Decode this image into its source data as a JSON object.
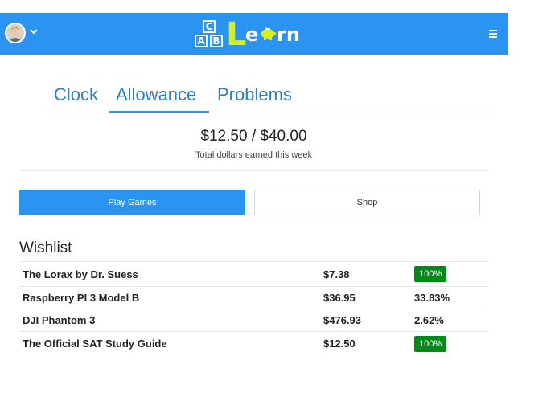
{
  "header": {
    "logo": {
      "blocks": [
        "C",
        "A",
        "B"
      ],
      "word_letters": [
        "L",
        "e",
        "rn"
      ],
      "pig_icon": "piggy-bank-icon"
    },
    "avatar_icon": "user-avatar",
    "dropdown_icon": "chevron-down-icon",
    "menu_icon": "hamburger-menu-icon",
    "bar_color": "#2b93f0"
  },
  "tabs": [
    {
      "label": "Clock",
      "active": false
    },
    {
      "label": "Allowance",
      "active": true
    },
    {
      "label": "Problems",
      "active": false
    }
  ],
  "allowance": {
    "amount": "$12.50 / $40.00",
    "subtitle": "Total dollars earned this week"
  },
  "buttons": {
    "play": "Play Games",
    "shop": "Shop"
  },
  "wishlist": {
    "title": "Wishlist",
    "items": [
      {
        "name": "The Lorax by Dr. Suess",
        "price": "$7.38",
        "progress": "100%",
        "complete": true
      },
      {
        "name": "Raspberry PI 3 Model B",
        "price": "$36.95",
        "progress": "33.83%",
        "complete": false
      },
      {
        "name": "DJI Phantom 3",
        "price": "$476.93",
        "progress": "2.62%",
        "complete": false
      },
      {
        "name": "The Official SAT Study Guide",
        "price": "$12.50",
        "progress": "100%",
        "complete": true
      }
    ]
  },
  "colors": {
    "accent": "#2b93f0",
    "tab_text": "#2f7ec1",
    "logo_L": "#d7f01a",
    "complete_badge": "#008a16"
  }
}
